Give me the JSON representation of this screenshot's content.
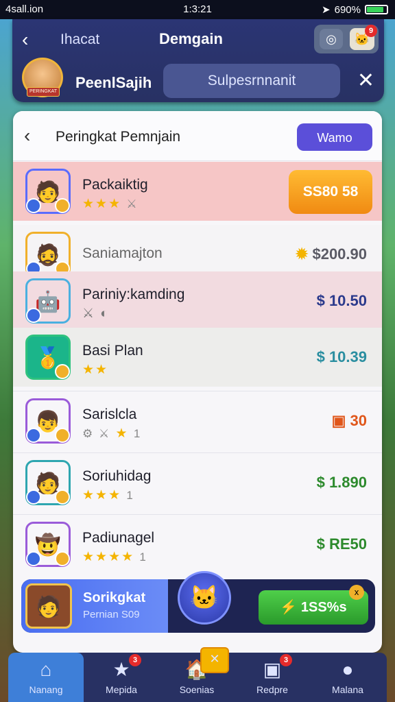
{
  "status_bar": {
    "carrier": "4sall.ion",
    "time": "1:3:21",
    "battery": "690%"
  },
  "header": {
    "back_label": "Ihacat",
    "title": "Demgain",
    "notification_count": "9",
    "profile_name": "PeenlSajih",
    "profile_badge": "PERINGKAT",
    "search_placeholder": "Sulpesrnnanit"
  },
  "leaderboard": {
    "title": "Peringkat Pemnjain",
    "action_label": "Wamo",
    "rows": [
      {
        "name": "Packaiktig",
        "stars": "★★★",
        "extra": "⚔",
        "value": "SS80 58",
        "color": "#ffffff"
      },
      {
        "name": "Saniamajton",
        "stars": "",
        "extra": "",
        "value": "$200.90",
        "color": "#5b5b66"
      },
      {
        "name": "Pariniy:kamding",
        "stars": "",
        "extra": "",
        "value": "$ 10.50",
        "color": "#2b3a8c"
      },
      {
        "name": "Basi Plan",
        "stars": "★★",
        "extra": "",
        "value": "$ 10.39",
        "color": "#2a8ea0"
      },
      {
        "name": "Sarislcla",
        "stars": "★",
        "extra": "1",
        "value": "30",
        "color": "#e0561a"
      },
      {
        "name": "Soriuhidag",
        "stars": "★★★",
        "extra": "1",
        "value": "$ 1.890",
        "color": "#2d8a2d"
      },
      {
        "name": "Padiunagel",
        "stars": "★★★★",
        "extra": "1",
        "value": "$ RE50",
        "color": "#2d8a2d"
      }
    ]
  },
  "promo": {
    "title": "Sorikgkat",
    "subtitle": "Pernian S09",
    "button": "1SS%s",
    "badge": "x"
  },
  "tabs": [
    {
      "label": "Nanang",
      "badge": ""
    },
    {
      "label": "Mepida",
      "badge": "3"
    },
    {
      "label": "Soenias",
      "badge": ""
    },
    {
      "label": "Redpre",
      "badge": "3"
    },
    {
      "label": "Malana",
      "badge": ""
    }
  ]
}
